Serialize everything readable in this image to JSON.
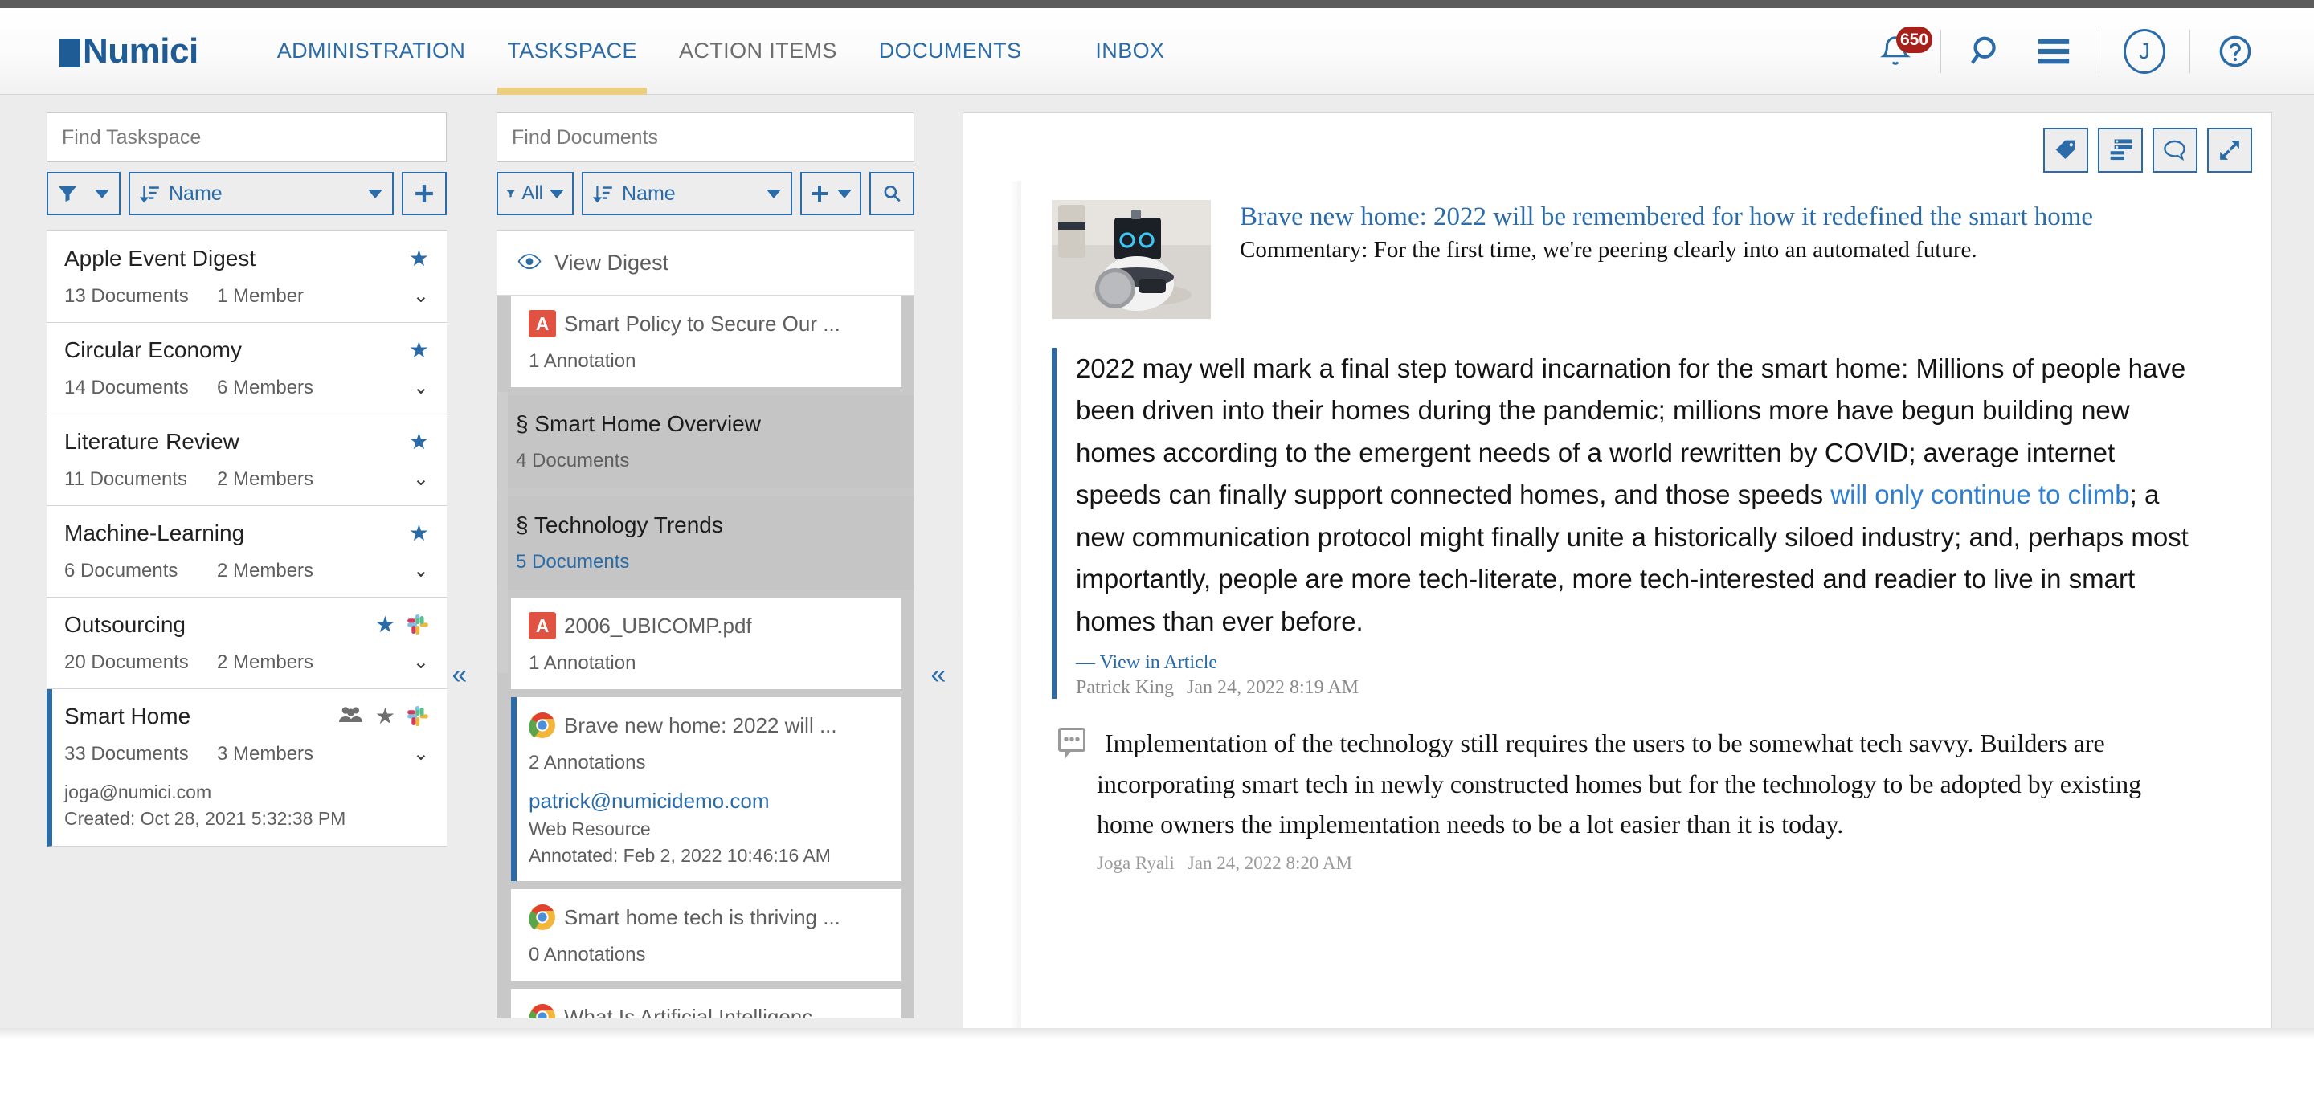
{
  "header": {
    "logo": "Numici",
    "nav": [
      {
        "label": "ADMINISTRATION",
        "state": "link"
      },
      {
        "label": "TASKSPACE",
        "state": "active"
      },
      {
        "label": "ACTION ITEMS",
        "state": "muted"
      },
      {
        "label": "DOCUMENTS",
        "state": "link"
      },
      {
        "label": "INBOX",
        "state": "link"
      }
    ],
    "notification_count": "650",
    "avatar_initial": "J",
    "icons": {
      "bell": "bell-icon",
      "search": "search-icon",
      "menu": "hamburger-menu-icon",
      "help": "help-icon"
    },
    "accent_color": "#2a6ba8",
    "badge_color": "#a8201a",
    "active_underline_color": "#edce80"
  },
  "taskspace_panel": {
    "search_placeholder": "Find Taskspace",
    "search_value": "",
    "filter_label": "",
    "sort_label": "Name",
    "add_label": "+",
    "items": [
      {
        "name": "Apple Event Digest",
        "documents": "13 Documents",
        "members": "1 Member",
        "starred": true,
        "slack": false,
        "shared": false
      },
      {
        "name": "Circular Economy",
        "documents": "14 Documents",
        "members": "6 Members",
        "starred": true,
        "slack": false,
        "shared": false
      },
      {
        "name": "Literature Review",
        "documents": "11 Documents",
        "members": "2 Members",
        "starred": true,
        "slack": false,
        "shared": false
      },
      {
        "name": "Machine-Learning",
        "documents": "6 Documents",
        "members": "2 Members",
        "starred": true,
        "slack": false,
        "shared": false
      },
      {
        "name": "Outsourcing",
        "documents": "20 Documents",
        "members": "2 Members",
        "starred": true,
        "slack": true,
        "shared": false
      },
      {
        "name": "Smart Home",
        "documents": "33 Documents",
        "members": "3 Members",
        "starred": true,
        "slack": true,
        "shared": true,
        "owner": "joga@numici.com",
        "created": "Created: Oct 28, 2021 5:32:38 PM",
        "selected": true
      }
    ]
  },
  "documents_panel": {
    "search_placeholder": "Find Documents",
    "search_value": "",
    "filter_label": "All",
    "sort_label": "Name",
    "view_digest_label": "View Digest",
    "cards": [
      {
        "kind": "pdf",
        "title": "Smart Policy to Secure Our ...",
        "sub": "1 Annotation"
      },
      {
        "kind": "section",
        "title": "§ Smart Home Overview",
        "sub": "4 Documents",
        "sub_link": false
      },
      {
        "kind": "section",
        "title": "§ Technology Trends",
        "sub": "5 Documents",
        "sub_link": true
      },
      {
        "kind": "pdf",
        "title": "2006_UBICOMP.pdf",
        "sub": "1 Annotation"
      },
      {
        "kind": "web",
        "title": "Brave new home: 2022 will ...",
        "sub": "2 Annotations",
        "email": "patrick@numicidemo.com",
        "type_line": "Web Resource",
        "annotated": "Annotated: Feb 2, 2022 10:46:16 AM",
        "selected": true
      },
      {
        "kind": "web",
        "title": "Smart home tech is thriving ...",
        "sub": "0 Annotations"
      },
      {
        "kind": "web",
        "title": "What Is Artificial Intelligenc...",
        "sub": ""
      }
    ]
  },
  "main_panel": {
    "toolbar": [
      {
        "icon": "tag-icon",
        "name": "tag-button"
      },
      {
        "icon": "summary-list-icon",
        "name": "summary-button"
      },
      {
        "icon": "comment-icon",
        "name": "comment-button"
      },
      {
        "icon": "expand-icon",
        "name": "expand-button"
      }
    ],
    "article": {
      "title": "Brave new home: 2022 will be remembered for how it redefined the smart home",
      "subtitle": "Commentary: For the first time, we're peering clearly into an automated future.",
      "thumbnail_alt": "astro-robot-photo"
    },
    "highlight": {
      "text_before": "2022 may well mark a final step toward incarnation for the smart home: Millions of people have been driven into their homes during the pandemic; millions more have begun building new homes according to the emergent needs of a world rewritten by COVID; average internet speeds can finally support connected homes, and those speeds ",
      "link_text": "will only continue to climb",
      "text_after": "; a new communication protocol might finally unite a historically siloed industry; and, perhaps most importantly, people are more tech-literate, more tech-interested and readier to live in smart homes than ever before.",
      "view_in_article": "— View in Article",
      "author": "Patrick King",
      "timestamp": "Jan 24, 2022 8:19 AM"
    },
    "comment": {
      "text": "Implementation of the technology still requires the users to be somewhat tech savvy. Builders are incorporating smart tech in newly constructed homes but for the technology to be adopted by existing home owners the implementation needs to be a lot easier than it is today.",
      "author": "Joga Ryali",
      "timestamp": "Jan 24, 2022 8:20 AM"
    }
  },
  "collapse_handles": {
    "taskspace": "«",
    "documents": "«"
  }
}
